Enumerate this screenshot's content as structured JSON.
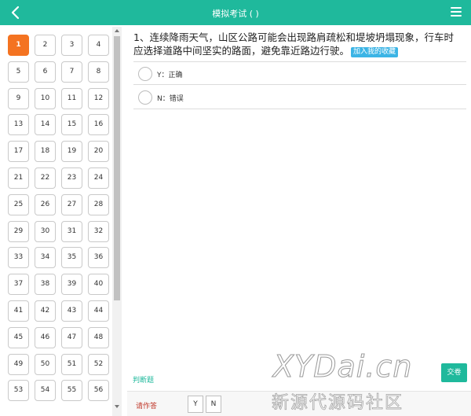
{
  "header": {
    "title": "模拟考试 ( )",
    "back_icon": "chevron-left-icon",
    "menu_icon": "hamburger-menu-icon",
    "bg_color": "#1fb99c"
  },
  "numbers": {
    "current": 1,
    "items": [
      "1",
      "2",
      "3",
      "4",
      "5",
      "6",
      "7",
      "8",
      "9",
      "10",
      "11",
      "12",
      "13",
      "14",
      "15",
      "16",
      "17",
      "18",
      "19",
      "20",
      "21",
      "22",
      "23",
      "24",
      "25",
      "26",
      "27",
      "28",
      "29",
      "30",
      "31",
      "32",
      "33",
      "34",
      "35",
      "36",
      "37",
      "38",
      "39",
      "40",
      "41",
      "42",
      "43",
      "44",
      "45",
      "46",
      "47",
      "48",
      "49",
      "50",
      "51",
      "52",
      "53",
      "54",
      "55",
      "56"
    ],
    "active_color": "#f47321"
  },
  "question": {
    "text": "1、连续降雨天气，山区公路可能会出现路肩疏松和堤坡坍塌现象，行车时应选择道路中间坚实的路面，避免靠近路边行驶。",
    "fav_label": "加入我的收藏",
    "options": [
      {
        "label": "Y：正确"
      },
      {
        "label": "N：错误"
      }
    ]
  },
  "footer": {
    "type_label": "判断题",
    "submit_label": "交卷",
    "answer_label": "请作答",
    "answer_buttons": [
      "Y",
      "N"
    ]
  },
  "watermark": {
    "logo": "XYDai.cn",
    "sub": "新源代源码社区"
  }
}
